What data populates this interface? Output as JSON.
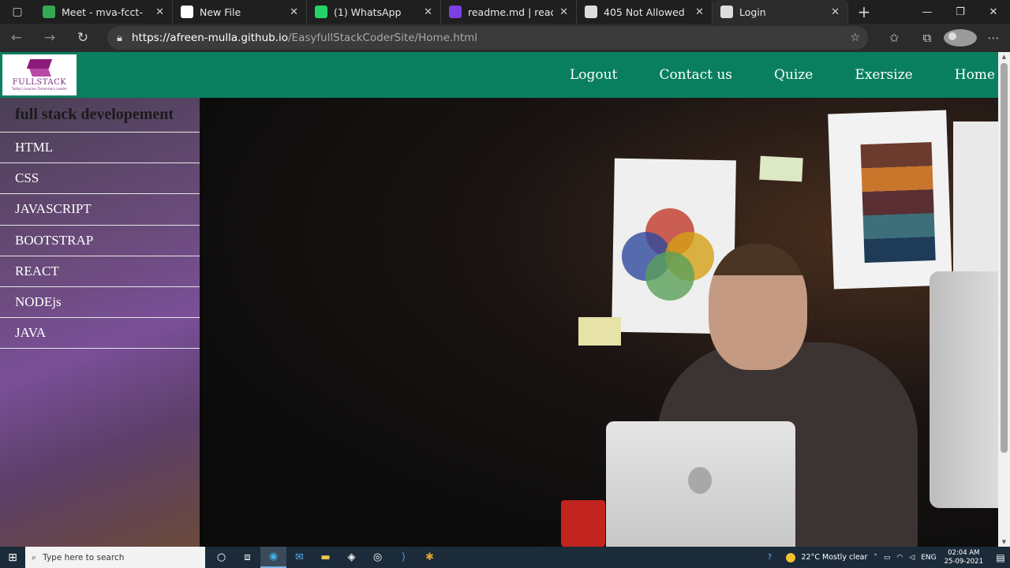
{
  "browser": {
    "tabs": [
      {
        "title": "Meet - mva-fcct-",
        "icon": "meet-icon",
        "fav_color": "#34a853",
        "active": false,
        "width": 175
      },
      {
        "title": "New File",
        "icon": "github-icon",
        "fav_color": "#ffffff",
        "active": false,
        "width": 170
      },
      {
        "title": "(1) WhatsApp",
        "icon": "whatsapp-icon",
        "fav_color": "#25d366",
        "active": false,
        "width": 170
      },
      {
        "title": "readme.md | readme.r",
        "icon": "readme-icon",
        "fav_color": "#7b3fe4",
        "active": false,
        "width": 172
      },
      {
        "title": "405 Not Allowed",
        "icon": "page-icon",
        "fav_color": "#dddddd",
        "active": false,
        "width": 172
      },
      {
        "title": "Login",
        "icon": "page-icon",
        "fav_color": "#dddddd",
        "active": true,
        "width": 172
      }
    ],
    "url_host": "https://afreen-mulla.github.io",
    "url_path": "/EasyfullStackCoderSite/Home.html"
  },
  "site": {
    "logo_text": "FULLSTACK",
    "logo_sub": "Today's Learner Tomorrow's Leader",
    "nav_links": [
      "Logout",
      "Contact us",
      "Quize",
      "Exersize",
      "Home"
    ],
    "sidebar_heading": "full stack developement",
    "sidebar_items": [
      "HTML",
      "CSS",
      "JAVASCRIPT",
      "BOOTSTRAP",
      "REACT",
      "NODEjs",
      "JAVA"
    ],
    "colors": {
      "navbar": "#0a7f5f",
      "sidebar_accent": "#7a4f98"
    }
  },
  "taskbar": {
    "search_placeholder": "Type here to search",
    "weather": "22°C  Mostly clear",
    "lang": "ENG",
    "time": "02:04 AM",
    "date": "25-09-2021"
  }
}
